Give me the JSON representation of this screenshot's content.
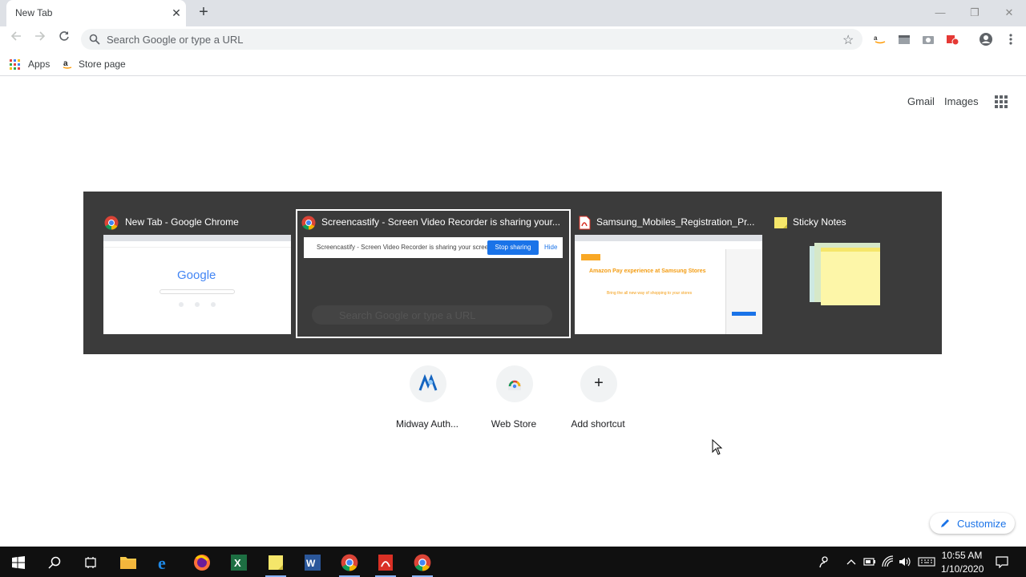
{
  "browser": {
    "tab": {
      "title": "New Tab",
      "close": "✕"
    },
    "new_tab": "+",
    "window_controls": {
      "minimize": "—",
      "restore": "❐",
      "close": "✕"
    }
  },
  "toolbar": {
    "omnibox": {
      "placeholder": "Search Google or type a URL",
      "value": ""
    }
  },
  "bookmarks": {
    "items": [
      {
        "label": "Apps",
        "icon": "apps-grid-icon"
      },
      {
        "label": "Store page",
        "icon": "amazon-icon"
      }
    ]
  },
  "ntp": {
    "gmail": "Gmail",
    "images": "Images",
    "shortcuts": [
      {
        "label": "Midway Auth...",
        "icon": "midway-icon"
      },
      {
        "label": "Web Store",
        "icon": "webstore-icon"
      },
      {
        "label": "Add shortcut",
        "icon": "plus-icon",
        "glyph": "+"
      }
    ],
    "customize": "Customize"
  },
  "switcher": {
    "windows": [
      {
        "title": "New Tab - Google Chrome",
        "icon": "chrome-icon",
        "thumb_logo": "Google"
      },
      {
        "title": "Screencastify - Screen Video Recorder is sharing your...",
        "icon": "chrome-icon",
        "banner_text": "Screencastify - Screen Video Recorder is sharing your screen.",
        "banner_button": "Stop sharing",
        "banner_hide": "Hide",
        "ghost_search": "Search Google or type a URL"
      },
      {
        "title": "Samsung_Mobiles_Registration_Pr...",
        "icon": "pdf-icon",
        "heading": "Amazon Pay experience at Samsung Stores",
        "subheading": "Bring the all new way of shopping to your stores"
      },
      {
        "title": "Sticky Notes",
        "icon": "sticky-notes-icon"
      }
    ],
    "selected_index": 1
  },
  "taskbar": {
    "items": [
      "windows-start-icon",
      "search-icon",
      "task-view-icon",
      "file-explorer-icon",
      "edge-icon",
      "firefox-icon",
      "excel-icon",
      "sticky-notes-icon",
      "word-icon",
      "chrome-icon",
      "acrobat-icon",
      "chrome-icon"
    ],
    "clock": {
      "time": "10:55 AM",
      "date": "1/10/2020"
    }
  },
  "colors": {
    "accent": "#1a73e8",
    "switcher_bg": "#3b3b3b",
    "tabstrip": "#dee1e6"
  }
}
